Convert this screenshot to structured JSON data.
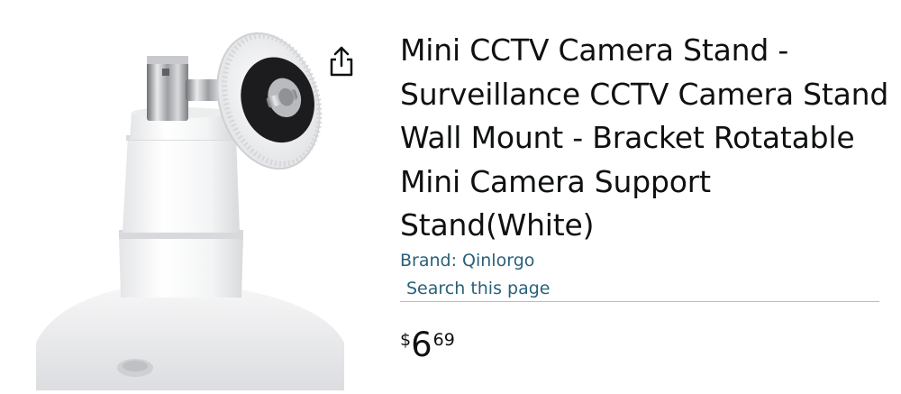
{
  "product": {
    "title": "Mini CCTV Camera Stand - Surveillance CCTV Camera Stand Wall Mount - Bracket Rotatable Mini Camera Support Stand(White)",
    "brand_link": "Brand: Qinlorgo",
    "search_link": "Search this page",
    "image_alt": "white-cctv-wall-mount-stand"
  },
  "price": {
    "symbol": "$",
    "whole": "6",
    "fraction": "69"
  },
  "icons": {
    "share": "share-icon"
  },
  "colors": {
    "link": "#2a6179",
    "text": "#0f1111",
    "divider": "#b8bdbd"
  }
}
